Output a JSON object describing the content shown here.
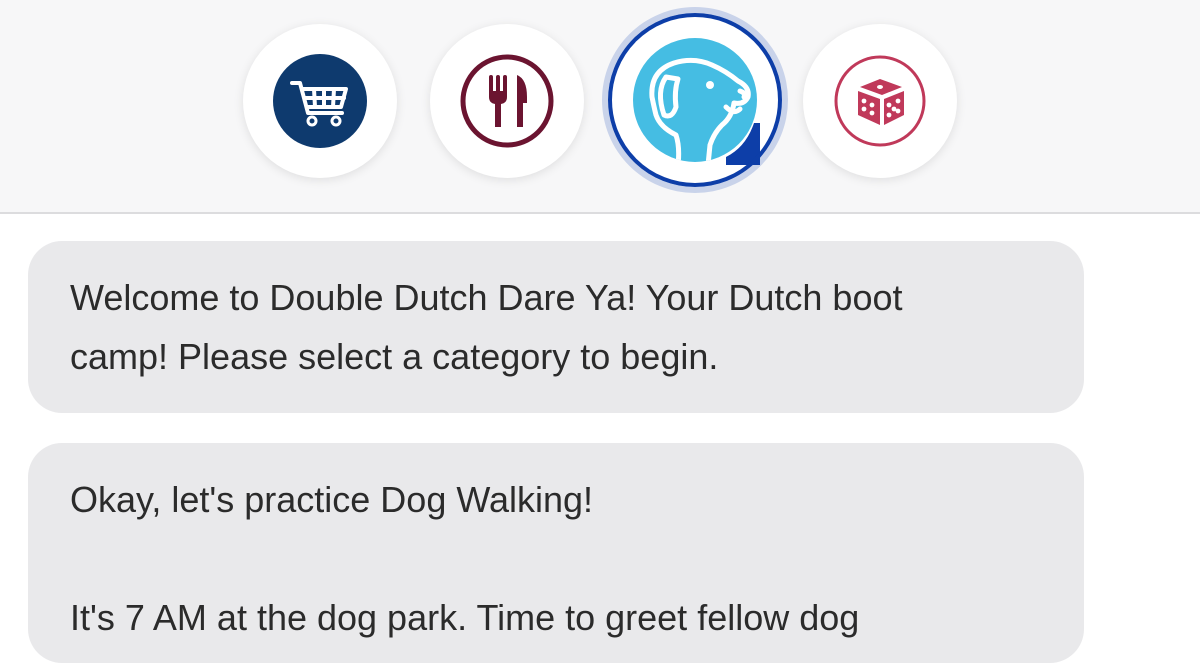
{
  "categories": [
    {
      "name": "shopping",
      "icon": "shopping-cart-icon",
      "color": "#0e3a6e",
      "selected": false
    },
    {
      "name": "dining",
      "icon": "fork-knife-icon",
      "color": "#6b1430",
      "selected": false
    },
    {
      "name": "dog-walking",
      "icon": "dog-icon",
      "color": "#45bde3",
      "selected": true
    },
    {
      "name": "games",
      "icon": "dice-icon",
      "color": "#c0395a",
      "selected": false
    }
  ],
  "messages": [
    {
      "lines": [
        "Welcome to Double Dutch Dare Ya! Your Dutch boot",
        "camp! Please select a category to begin."
      ]
    },
    {
      "line1": "Okay, let's practice Dog Walking!",
      "line2": "It's 7 AM at the dog park. Time to greet fellow dog"
    }
  ],
  "colors": {
    "bubble": "#e9e9eb",
    "selected_ring": "#0d3ea8",
    "header_bg": "#f7f7f8"
  }
}
